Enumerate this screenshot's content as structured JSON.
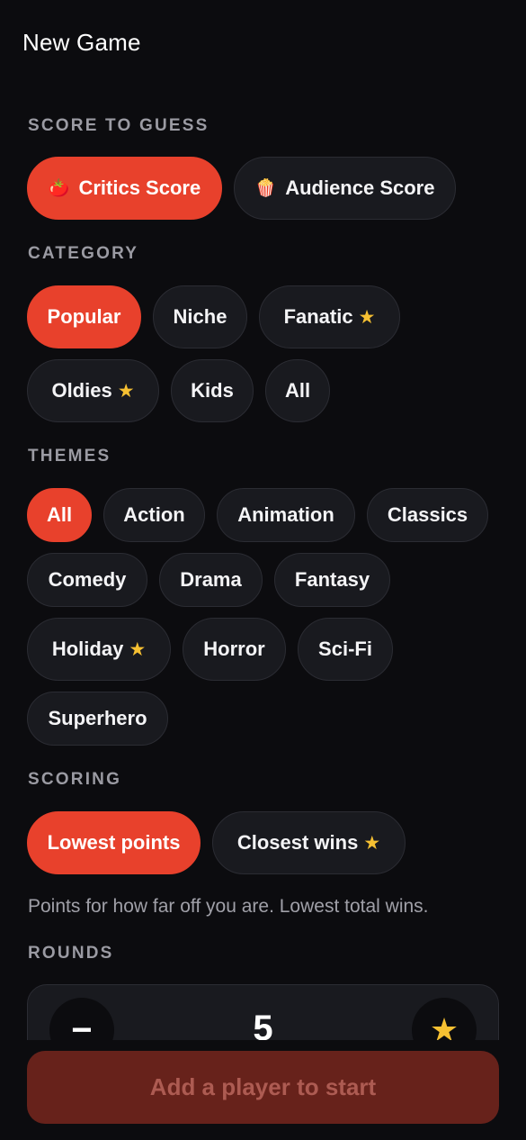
{
  "header": {
    "title": "New Game"
  },
  "score_section": {
    "label": "SCORE TO GUESS",
    "options": [
      {
        "label": "Critics Score",
        "icon": "tomato-icon",
        "selected": true
      },
      {
        "label": "Audience Score",
        "icon": "popcorn-icon",
        "selected": false
      }
    ]
  },
  "category_section": {
    "label": "CATEGORY",
    "options": [
      {
        "label": "Popular",
        "selected": true,
        "premium": false
      },
      {
        "label": "Niche",
        "selected": false,
        "premium": false
      },
      {
        "label": "Fanatic",
        "selected": false,
        "premium": true
      },
      {
        "label": "Oldies",
        "selected": false,
        "premium": true
      },
      {
        "label": "Kids",
        "selected": false,
        "premium": false
      },
      {
        "label": "All",
        "selected": false,
        "premium": false
      }
    ]
  },
  "themes_section": {
    "label": "THEMES",
    "options": [
      {
        "label": "All",
        "selected": true,
        "premium": false
      },
      {
        "label": "Action",
        "selected": false,
        "premium": false
      },
      {
        "label": "Animation",
        "selected": false,
        "premium": false
      },
      {
        "label": "Classics",
        "selected": false,
        "premium": false
      },
      {
        "label": "Comedy",
        "selected": false,
        "premium": false
      },
      {
        "label": "Drama",
        "selected": false,
        "premium": false
      },
      {
        "label": "Fantasy",
        "selected": false,
        "premium": false
      },
      {
        "label": "Holiday",
        "selected": false,
        "premium": true
      },
      {
        "label": "Horror",
        "selected": false,
        "premium": false
      },
      {
        "label": "Sci-Fi",
        "selected": false,
        "premium": false
      },
      {
        "label": "Superhero",
        "selected": false,
        "premium": false
      }
    ]
  },
  "scoring_section": {
    "label": "SCORING",
    "options": [
      {
        "label": "Lowest points",
        "selected": true,
        "premium": false
      },
      {
        "label": "Closest wins",
        "selected": false,
        "premium": true
      }
    ],
    "description": "Points for how far off you are. Lowest total wins."
  },
  "rounds_section": {
    "label": "ROUNDS",
    "decrement_label": "−",
    "value": "5"
  },
  "start_button": {
    "label": "Add a player to start"
  },
  "colors": {
    "accent": "#e8412c",
    "background": "#0c0c0f",
    "chip": "#191a1f",
    "star": "#f6c032",
    "start_disabled": "#67221b"
  }
}
